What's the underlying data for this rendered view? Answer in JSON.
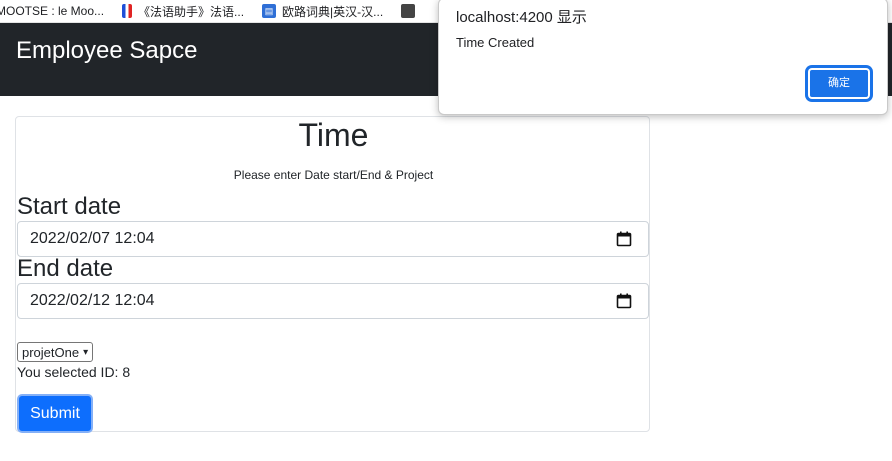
{
  "bookmarks": [
    {
      "label": "MOOTSE : le Moo...",
      "icon": "globe-icon"
    },
    {
      "label": "《法语助手》法语...",
      "icon": "france-flag-icon"
    },
    {
      "label": "欧路词典|英汉-汉...",
      "icon": "dictionary-icon"
    },
    {
      "label": "",
      "icon": "bookmark-icon"
    }
  ],
  "navbar": {
    "brand": "Employee Sapce",
    "bg": "#212529"
  },
  "form": {
    "title": "Time",
    "subtitle": "Please enter Date start/End & Project",
    "start_label": "Start date",
    "start_value": "2022/02/07 12:04",
    "end_label": "End date",
    "end_value": "2022/02/12 12:04",
    "project_selected": "projetOne",
    "selected_text": "You selected ID: 8",
    "submit_label": "Submit",
    "submit_color": "#0d6efd"
  },
  "alert": {
    "origin": "localhost:4200 显示",
    "message": "Time Created",
    "ok_label": "确定",
    "ok_color": "#1a73e8"
  }
}
